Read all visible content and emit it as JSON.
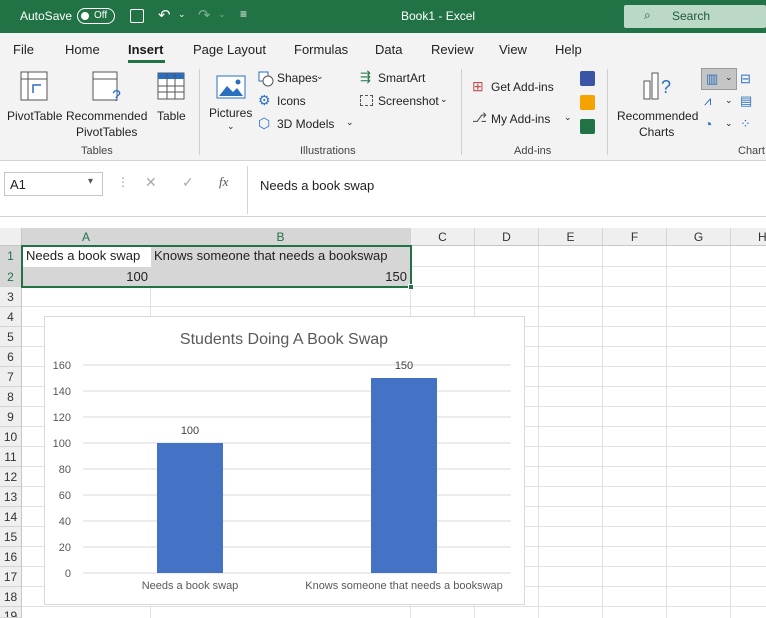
{
  "titlebar": {
    "autosave_label": "AutoSave",
    "autosave_state": "Off",
    "title": "Book1  -  Excel",
    "search_placeholder": "Search"
  },
  "menu": {
    "tabs": [
      "File",
      "Home",
      "Insert",
      "Page Layout",
      "Formulas",
      "Data",
      "Review",
      "View",
      "Help"
    ],
    "active": "Insert"
  },
  "ribbon": {
    "tables": {
      "pivot": "PivotTable",
      "rec1": "Recommended",
      "rec2": "PivotTables",
      "table": "Table",
      "group": "Tables"
    },
    "illustrations": {
      "pictures": "Pictures",
      "shapes": "Shapes",
      "icons": "Icons",
      "models": "3D Models",
      "smartart": "SmartArt",
      "screenshot": "Screenshot",
      "group": "Illustrations"
    },
    "addins": {
      "get": "Get Add-ins",
      "my": "My Add-ins",
      "group": "Add-ins"
    },
    "charts": {
      "rec1": "Recommended",
      "rec2": "Charts",
      "group": "Chart"
    }
  },
  "formula": {
    "namebox": "A1",
    "fx": "fx",
    "content": "Needs a book swap"
  },
  "sheet": {
    "columns": [
      "A",
      "B",
      "C",
      "D",
      "E",
      "F",
      "G",
      "H"
    ],
    "rows": [
      "1",
      "2",
      "3",
      "4",
      "5",
      "6",
      "7",
      "8",
      "9",
      "10",
      "11",
      "12",
      "13",
      "14",
      "15",
      "16",
      "17",
      "18",
      "19"
    ],
    "a1": "Needs a book swap",
    "b1": "Knows someone that needs a bookswap",
    "a2": "100",
    "b2": "150"
  },
  "chart_data": {
    "type": "bar",
    "title": "Students Doing A Book Swap",
    "categories": [
      "Needs a book swap",
      "Knows someone that needs a bookswap"
    ],
    "values": [
      100,
      150
    ],
    "ylim": [
      0,
      160
    ],
    "yticks": [
      "0",
      "20",
      "40",
      "60",
      "80",
      "100",
      "120",
      "140",
      "160"
    ],
    "bar_color": "#4472c4",
    "grid": true
  },
  "colors": {
    "excel_green": "#217346",
    "bar": "#4472c4"
  }
}
